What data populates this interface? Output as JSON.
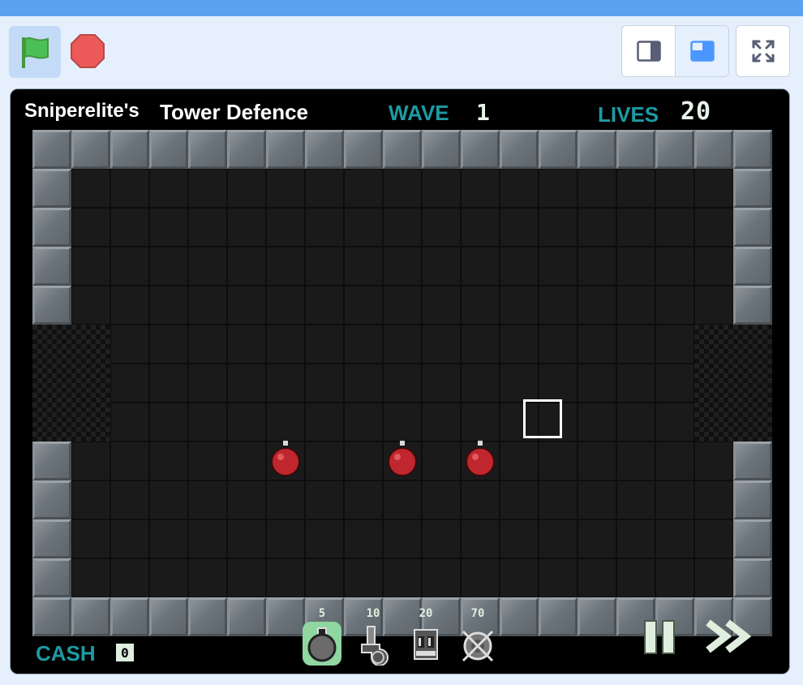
{
  "topbar": {
    "flag_icon": "green-flag-icon",
    "stop_icon": "stop-icon",
    "view_modes": [
      "small-stage-icon",
      "normal-stage-icon"
    ],
    "fullscreen_icon": "fullscreen-icon"
  },
  "hud": {
    "creator": "Sniperelite's",
    "title": "Tower Defence",
    "wave_label": "WAVE",
    "wave_value": "1",
    "lives_label": "LIVES",
    "lives_value": "20",
    "cash_label": "CASH",
    "cash_value": "0"
  },
  "towers": [
    {
      "cost": "5",
      "icon": "bomb-tower-icon",
      "selected": true
    },
    {
      "cost": "10",
      "icon": "cannon-tower-icon",
      "selected": false
    },
    {
      "cost": "20",
      "icon": "robot-tower-icon",
      "selected": false
    },
    {
      "cost": "70",
      "icon": "gear-tower-icon",
      "selected": false
    }
  ],
  "controls": {
    "pause_icon": "pause-icon",
    "fast_forward_icon": "fast-forward-icon"
  },
  "colors": {
    "accent": "#1d9aa3",
    "topbar": "#5aa1ef",
    "enemy": "#c0262d",
    "stage": "#000000"
  }
}
